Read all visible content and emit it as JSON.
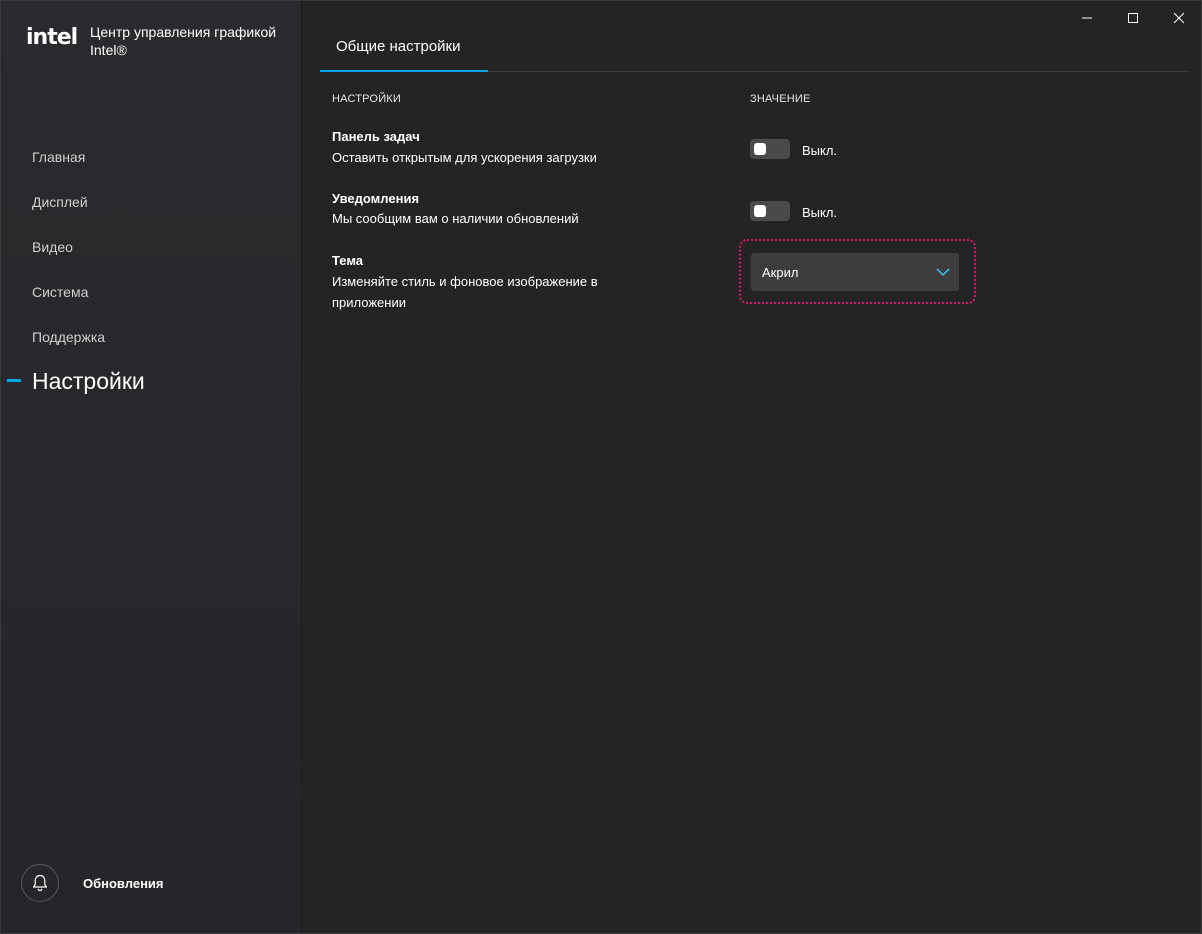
{
  "app": {
    "logo": "intel",
    "title": "Центр управления графикой Intel®"
  },
  "window_controls": {
    "minimize_icon": "minimize-icon",
    "maximize_icon": "maximize-icon",
    "close_icon": "close-icon"
  },
  "sidebar": {
    "items": [
      {
        "label": "Главная"
      },
      {
        "label": "Дисплей"
      },
      {
        "label": "Видео"
      },
      {
        "label": "Система"
      },
      {
        "label": "Поддержка"
      },
      {
        "label": "Настройки",
        "active": true
      }
    ],
    "updates": {
      "label": "Обновления",
      "icon": "bell-icon"
    }
  },
  "main": {
    "tab": {
      "label": "Общие настройки"
    },
    "columns": {
      "settings": "НАСТРОЙКИ",
      "value": "ЗНАЧЕНИЕ"
    },
    "settings": [
      {
        "title": "Панель задач",
        "description": "Оставить открытым для ускорения загрузки",
        "control": "toggle",
        "value": "Выкл."
      },
      {
        "title": "Уведомления",
        "description": "Мы сообщим вам о наличии обновлений",
        "control": "toggle",
        "value": "Выкл."
      },
      {
        "title": "Тема",
        "description": "Изменяйте стиль и фоновое изображение в приложении",
        "control": "dropdown",
        "value": "Акрил"
      }
    ]
  },
  "colors": {
    "accent": "#00a6e8",
    "focus_ring": "#e0156e",
    "background": "#242424"
  }
}
